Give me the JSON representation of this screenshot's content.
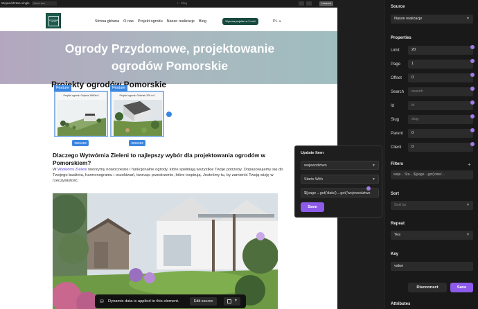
{
  "topbar": {
    "title": "Województwa single",
    "select_value": "Select item",
    "center": "/ ◦ blog",
    "save": "Unsaved"
  },
  "site": {
    "logo_text": "WYTWÓRNIA ZIELENI",
    "nav": [
      "Strona główna",
      "O nas",
      "Projekt ogrodu",
      "Nasze realizacje",
      "Blog"
    ],
    "cta": "Wycena projektu w 2 min!",
    "lang": "PL"
  },
  "hero": {
    "title": "Ogrody Przydomowe, projektowanie ogrodów Pomorskie"
  },
  "projects": {
    "title": "Projekty ogrodów Pomorskie",
    "cards": [
      {
        "badge": "Feature",
        "caption": "Projekt ogrodu Gdynia 1860m2",
        "size": "302x253"
      },
      {
        "badge": "Feature",
        "caption": "Projekt ogrodu Gdańsk 200 m2",
        "size": "302x253"
      }
    ]
  },
  "why": {
    "title": "Dlaczego Wytwórnia Zieleni to najlepszy wybór dla projektowania ogrodów w Pomorskiem?",
    "text_before": "W ",
    "link": "Wytwórni Zieleni",
    "text_after": " tworzymy nowoczesne i funkcjonalne ogrody, które spełniają wszystkie Twoje potrzeby. Dopasowujemy się do Twojego budżetu, harmonogramu i oczekiwań, tworząc przestrzenie, które inspirują. Jesteśmy tu, by zamienić Twoją wizję w rzeczywistość."
  },
  "update_item": {
    "title": "Update Item",
    "field": "wojewodztwo",
    "operator": "Starts With",
    "expression": "${page→get('data')→get('wojewodztwo",
    "save": "Save"
  },
  "dynamic_bar": {
    "text": "Dynamic data is applied to this element.",
    "edit": "Edit source"
  },
  "panel": {
    "source_label": "Source",
    "source_value": "Nasze realizacje",
    "properties_label": "Properties",
    "props": [
      {
        "label": "Limit",
        "value": "20",
        "placeholder": ""
      },
      {
        "label": "Page",
        "value": "1",
        "placeholder": ""
      },
      {
        "label": "Offset",
        "value": "0",
        "placeholder": ""
      },
      {
        "label": "Search",
        "value": "",
        "placeholder": "search"
      },
      {
        "label": "Id",
        "value": "",
        "placeholder": "id"
      },
      {
        "label": "Slug",
        "value": "",
        "placeholder": "slug"
      },
      {
        "label": "Parent",
        "value": "0",
        "placeholder": ""
      },
      {
        "label": "Client",
        "value": "0",
        "placeholder": ""
      }
    ],
    "filters_label": "Filters",
    "filter_chip": "woje...   Sta...   ${page→get('data'...",
    "sort_label": "Sort",
    "sort_placeholder": "Sort by",
    "repeat_label": "Repeat",
    "repeat_value": "Yes",
    "key_label": "Key",
    "key_value": "value",
    "disconnect": "Disconnect",
    "save": "Save",
    "attributes_label": "Attributes"
  },
  "colors": {
    "accent": "#8d5bea",
    "selection": "#3b86e0",
    "brand": "#17493f"
  }
}
